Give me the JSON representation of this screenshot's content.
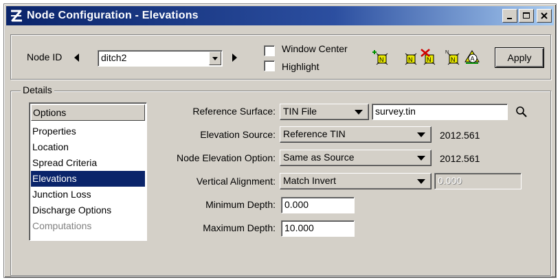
{
  "window": {
    "title": "Node Configuration - Elevations"
  },
  "top": {
    "node_id_label": "Node ID",
    "node_id_value": "ditch2",
    "window_center_label": "Window Center",
    "highlight_label": "Highlight",
    "apply_label": "Apply",
    "window_center_checked": false,
    "highlight_checked": false
  },
  "details": {
    "legend": "Details",
    "options_header": "Options",
    "options": [
      {
        "label": "Properties",
        "state": "normal"
      },
      {
        "label": "Location",
        "state": "normal"
      },
      {
        "label": "Spread Criteria",
        "state": "normal"
      },
      {
        "label": "Elevations",
        "state": "selected"
      },
      {
        "label": "Junction Loss",
        "state": "normal"
      },
      {
        "label": "Discharge Options",
        "state": "normal"
      },
      {
        "label": "Computations",
        "state": "disabled"
      }
    ],
    "reference_surface_label": "Reference Surface:",
    "reference_surface_type": "TIN File",
    "reference_surface_file": "survey.tin",
    "elevation_source_label": "Elevation Source:",
    "elevation_source_value": "Reference TIN",
    "elevation_source_readout": "2012.561",
    "node_elevation_option_label": "Node Elevation Option:",
    "node_elevation_option_value": "Same as Source",
    "node_elevation_readout": "2012.561",
    "vertical_alignment_label": "Vertical Alignment:",
    "vertical_alignment_value": "Match Invert",
    "vertical_alignment_field": "0.000",
    "minimum_depth_label": "Minimum Depth:",
    "minimum_depth_value": "0.000",
    "maximum_depth_label": "Maximum Depth:",
    "maximum_depth_value": "10.000"
  },
  "colors": {
    "title_bar": "#0a246a",
    "selection": "#0a246a",
    "face": "#d4d0c8"
  },
  "icons": [
    "app-logo-icon",
    "minimize-icon",
    "maximize-icon",
    "close-icon",
    "prev-arrow-icon",
    "next-arrow-icon",
    "add-node-icon",
    "edit-node-icon",
    "delete-node-icon",
    "node-settings-icon",
    "node-annotate-icon",
    "magnifier-icon"
  ]
}
